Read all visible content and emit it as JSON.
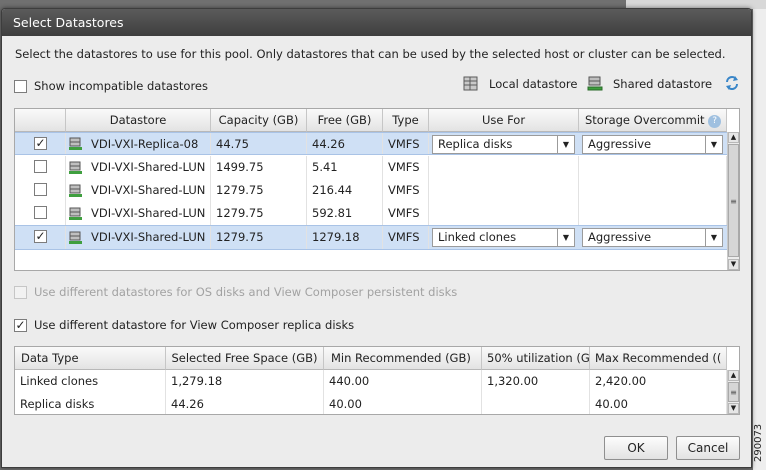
{
  "dialog": {
    "title": "Select Datastores",
    "intro": "Select the datastores to use for this pool. Only datastores that can be used by the selected host or cluster can be selected.",
    "show_incompatible_label": "Show incompatible datastores",
    "show_incompatible_checked": false,
    "legend": {
      "local_label": "Local datastore",
      "shared_label": "Shared datastore"
    },
    "icons": {
      "local": "local-datastore-icon",
      "shared": "shared-datastore-icon",
      "refresh": "refresh-icon",
      "help": "help-icon"
    }
  },
  "datastore_grid": {
    "columns": [
      "Datastore",
      "Capacity (GB)",
      "Free (GB)",
      "Type",
      "Use For",
      "Storage Overcommit"
    ],
    "rows": [
      {
        "checked": "✓",
        "name": "VDI-VXI-Replica-08",
        "capacity": "44.75",
        "free": "44.26",
        "type": "VMFS",
        "use_for": "Replica disks",
        "overcommit": "Aggressive"
      },
      {
        "checked": "",
        "name": "VDI-VXI-Shared-LUN",
        "capacity": "1499.75",
        "free": "5.41",
        "type": "VMFS",
        "use_for": "",
        "overcommit": ""
      },
      {
        "checked": "",
        "name": "VDI-VXI-Shared-LUN",
        "capacity": "1279.75",
        "free": "216.44",
        "type": "VMFS",
        "use_for": "",
        "overcommit": ""
      },
      {
        "checked": "",
        "name": "VDI-VXI-Shared-LUN",
        "capacity": "1279.75",
        "free": "592.81",
        "type": "VMFS",
        "use_for": "",
        "overcommit": ""
      },
      {
        "checked": "✓",
        "name": "VDI-VXI-Shared-LUN",
        "capacity": "1279.75",
        "free": "1279.18",
        "type": "VMFS",
        "use_for": "Linked clones",
        "overcommit": "Aggressive"
      }
    ]
  },
  "options": {
    "different_os_label": "Use different datastores for OS disks and View Composer persistent disks",
    "different_os_checked": false,
    "different_os_enabled": false,
    "different_replica_label": "Use different datastore for View Composer replica disks",
    "different_replica_checked": "✓"
  },
  "summary_grid": {
    "columns": [
      "Data Type",
      "Selected Free Space (GB)",
      "Min Recommended (GB)",
      "50% utilization (G",
      "Max Recommended (("
    ],
    "rows": [
      [
        "Linked clones",
        "1,279.18",
        "440.00",
        "1,320.00",
        "2,420.00"
      ],
      [
        "Replica disks",
        "44.26",
        "40.00",
        "",
        "40.00"
      ]
    ]
  },
  "buttons": {
    "ok": "OK",
    "cancel": "Cancel"
  },
  "figure_number": "290073",
  "colors": {
    "title_bar": "#4a4a4a",
    "selected_row": "#cfe0f5",
    "dialog_bg": "#ececec"
  }
}
